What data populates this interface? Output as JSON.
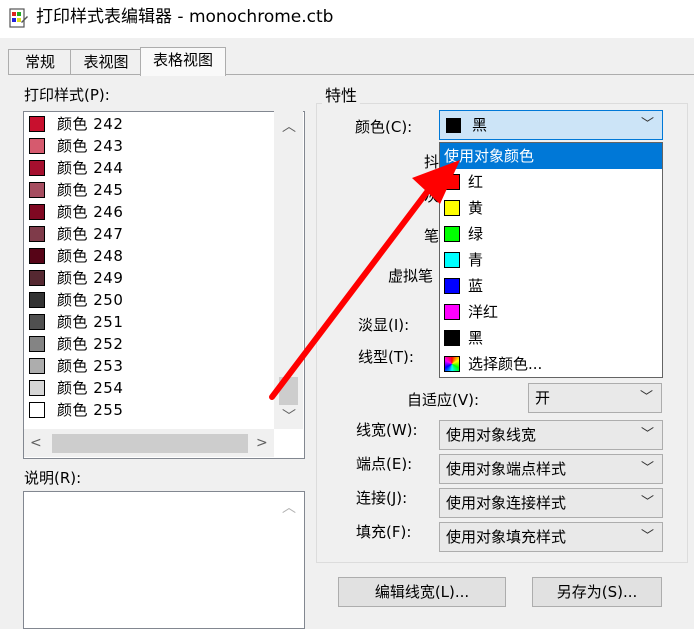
{
  "window": {
    "title": "打印样式表编辑器 - monochrome.ctb"
  },
  "tabs": [
    {
      "label": "常规",
      "active": false
    },
    {
      "label": "表视图",
      "active": false
    },
    {
      "label": "表格视图",
      "active": true
    }
  ],
  "left": {
    "styles_label": "打印样式(P):",
    "styles": [
      {
        "label": "颜色 242",
        "color": "#c8102e"
      },
      {
        "label": "颜色 243",
        "color": "#d65a6e"
      },
      {
        "label": "颜色 244",
        "color": "#a50f2e"
      },
      {
        "label": "颜色 245",
        "color": "#a64d60"
      },
      {
        "label": "颜色 246",
        "color": "#800822"
      },
      {
        "label": "颜色 247",
        "color": "#7f3b4a"
      },
      {
        "label": "颜色 248",
        "color": "#560417"
      },
      {
        "label": "颜色 249",
        "color": "#552831"
      },
      {
        "label": "颜色 250",
        "color": "#333333"
      },
      {
        "label": "颜色 251",
        "color": "#505050"
      },
      {
        "label": "颜色 252",
        "color": "#848484"
      },
      {
        "label": "颜色 253",
        "color": "#adadad"
      },
      {
        "label": "颜色 254",
        "color": "#d6d6d6"
      },
      {
        "label": "颜色 255",
        "color": "#ffffff"
      }
    ],
    "description_label": "说明(R):",
    "description_value": ""
  },
  "properties": {
    "group_title": "特性",
    "color_label": "颜色(C):",
    "color_value": "黑",
    "color_swatch": "#000000",
    "dither_label_partial": "抖",
    "grayscale_label_partial": "灰",
    "pen_label_partial": "笔",
    "virtual_pen_label_partial": "虚拟笔",
    "screening_label": "淡显(I):",
    "linetype_label": "线型(T):",
    "adaptive_label": "自适应(V):",
    "adaptive_value": "开",
    "lineweight_label": "线宽(W):",
    "lineweight_value": "使用对象线宽",
    "endstyle_label": "端点(E):",
    "endstyle_value": "使用对象端点样式",
    "joinstyle_label": "连接(J):",
    "joinstyle_value": "使用对象连接样式",
    "fillstyle_label": "填充(F):",
    "fillstyle_value": "使用对象填充样式"
  },
  "color_dropdown": {
    "options": [
      {
        "label": "使用对象颜色",
        "selected": true,
        "color": ""
      },
      {
        "label": "红",
        "color": "#ff0000"
      },
      {
        "label": "黄",
        "color": "#ffff00"
      },
      {
        "label": "绿",
        "color": "#00ff00"
      },
      {
        "label": "青",
        "color": "#00ffff"
      },
      {
        "label": "蓝",
        "color": "#0000ff"
      },
      {
        "label": "洋红",
        "color": "#ff00ff"
      },
      {
        "label": "黑",
        "color": "#000000"
      },
      {
        "label": "选择颜色...",
        "color": "rainbow"
      }
    ]
  },
  "buttons": {
    "edit_lineweights": "编辑线宽(L)...",
    "save_as": "另存为(S)..."
  },
  "annotation": {
    "arrow_color": "#ff0000"
  }
}
